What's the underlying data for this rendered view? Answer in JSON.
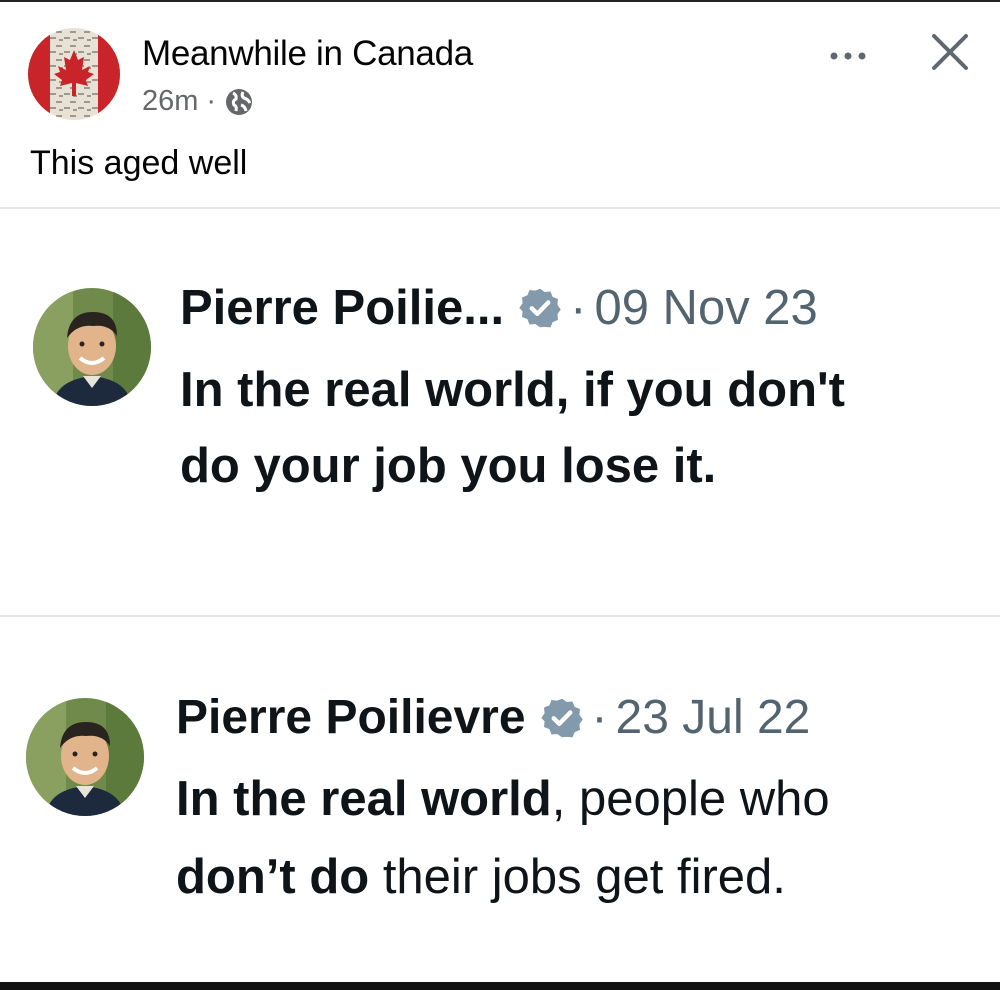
{
  "post": {
    "page_name": "Meanwhile in Canada",
    "time": "26m",
    "separator": "·",
    "caption": "This aged well",
    "more_label": "•••",
    "close_label": "✕"
  },
  "tweets": [
    {
      "name": "Pierre Poilie...",
      "separator": "·",
      "date": "09 Nov 23",
      "text_line1": "In the real world, if you don't",
      "text_line2": "do your job you lose it."
    },
    {
      "name": "Pierre Poilievre",
      "separator": "·",
      "date": "23 Jul 22",
      "line1_bold": "In the real world",
      "line1_rest": ", people who",
      "line2_bold": "don’t do",
      "line2_rest": " their jobs get fired."
    }
  ],
  "icons": {
    "avatar": "canada-flag-avatar",
    "globe": "globe-icon",
    "more": "more-options-icon",
    "close": "close-icon",
    "verified": "verified-badge-icon"
  },
  "colors": {
    "flag_red": "#c8242a",
    "badge_gray": "#829aab",
    "meta_gray": "#65676b"
  }
}
